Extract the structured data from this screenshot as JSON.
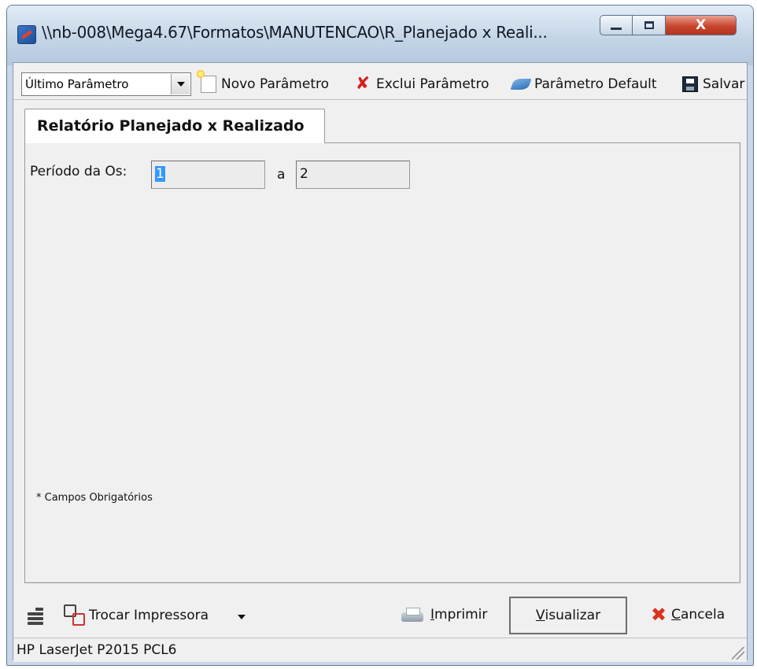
{
  "window": {
    "title": "\\\\nb-008\\Mega4.67\\Formatos\\MANUTENCAO\\R_Planejado x Reali...",
    "min_label": "",
    "max_label": "",
    "close_label": "X"
  },
  "toolbar": {
    "combo_value": "Último Parâmetro",
    "novo_label": "Novo Parâmetro",
    "exclui_label": "Exclui Parâmetro",
    "default_label": "Parâmetro Default",
    "salvar_label": "Salvar"
  },
  "tab": {
    "label": "Relatório  Planejado x Realizado"
  },
  "form": {
    "periodo_label": "Período da Os:",
    "from_value": "1",
    "separator": "a",
    "to_value": "2",
    "required_note": "* Campos Obrigatórios"
  },
  "bottom": {
    "trocar_label": "Trocar Impressora",
    "imprimir_prefix": "I",
    "imprimir_rest": "mprimir",
    "visualizar_prefix": "V",
    "visualizar_rest": "isualizar",
    "cancela_prefix": "C",
    "cancela_rest": "ancela"
  },
  "status": {
    "printer": "HP LaserJet P2015 PCL6"
  },
  "icons": {
    "app": "app-icon",
    "new": "new-document-icon",
    "delete": "delete-icon",
    "default": "default-parameter-icon",
    "save": "floppy-disk-icon",
    "printer_settings": "printer-settings-icon",
    "swap_printer": "swap-printer-icon",
    "print": "printer-icon",
    "cancel": "cancel-x-icon"
  }
}
